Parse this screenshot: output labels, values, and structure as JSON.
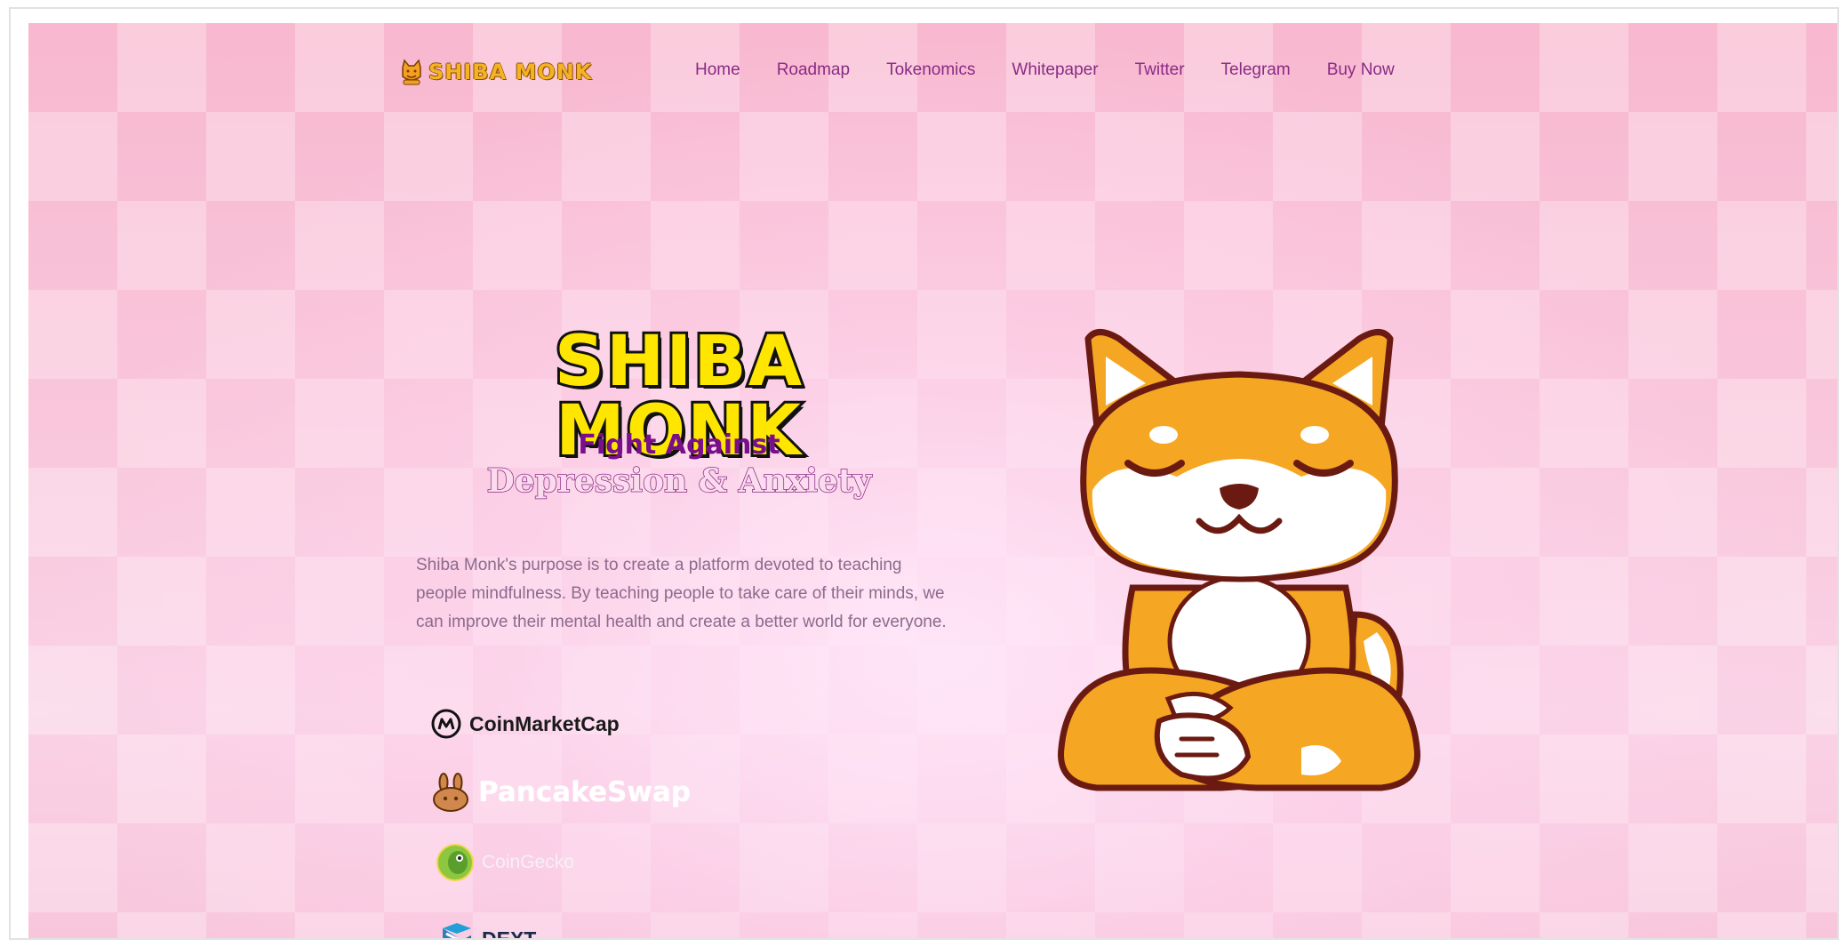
{
  "brand": {
    "name": "SHIBA MONK"
  },
  "nav": {
    "items": [
      "Home",
      "Roadmap",
      "Tokenomics",
      "Whitepaper",
      "Twitter",
      "Telegram",
      "Buy Now"
    ]
  },
  "hero": {
    "title": "SHIBA MONK",
    "subtitle_1": "Fight Against",
    "subtitle_2": "Depression & Anxiety",
    "description": "Shiba Monk's purpose is to create a platform devoted to teaching people mindfulness. By teaching people to take care of their minds, we can improve their mental health and create a better world for everyone."
  },
  "partners": {
    "coinmarketcap": "CoinMarketCap",
    "pancakeswap": "PancakeSwap",
    "coingecko": "CoinGecko",
    "dext": "DEXT"
  },
  "colors": {
    "nav_link": "#8a2a86",
    "title_fill": "#ffe600",
    "subtitle_purple": "#7a0f8c",
    "background_pink": "#f9c5da",
    "mascot_orange": "#f5a623"
  }
}
